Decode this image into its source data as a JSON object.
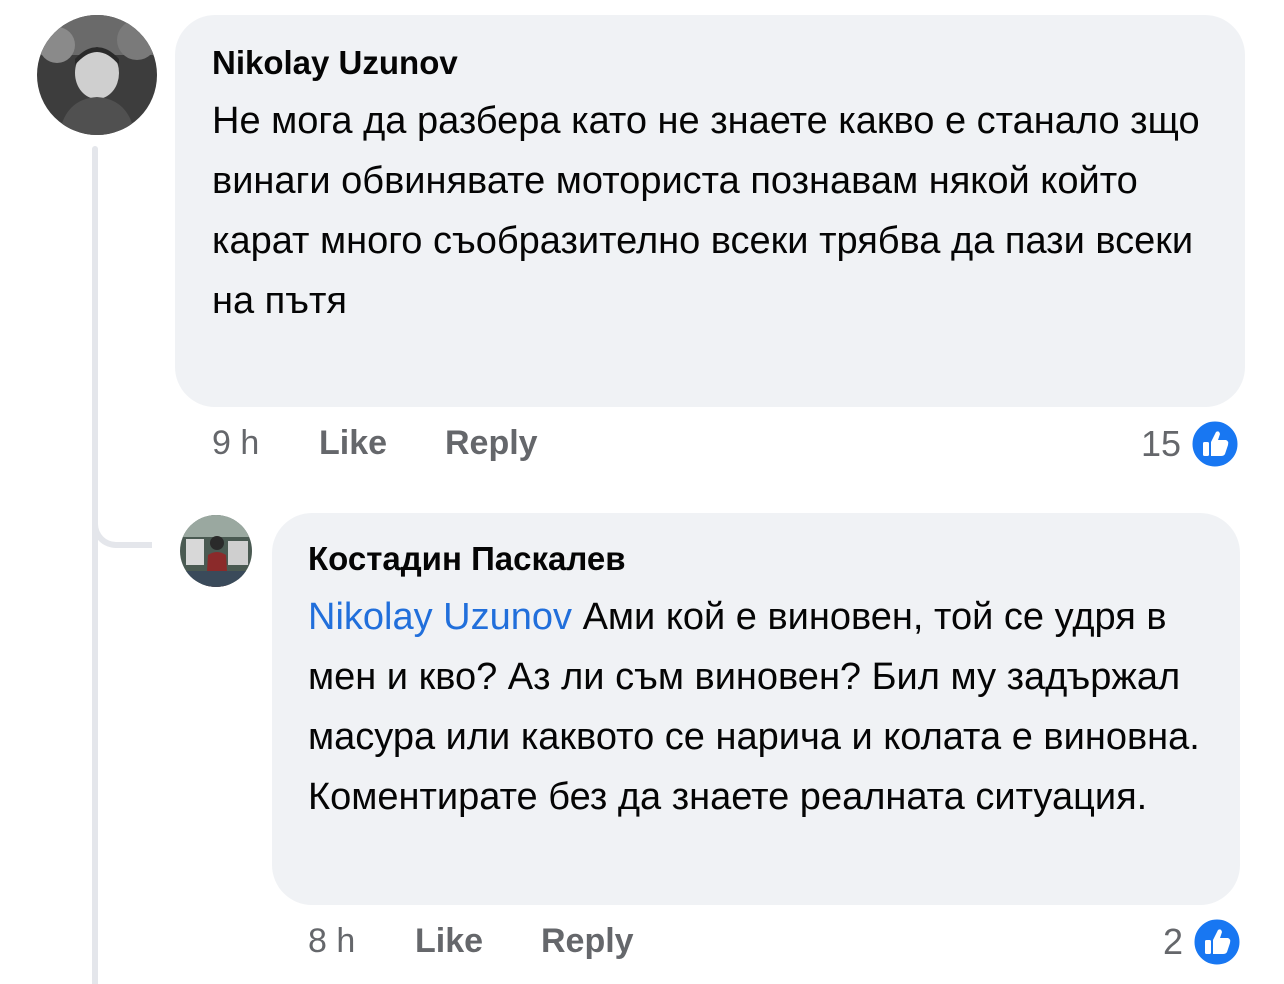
{
  "comments": [
    {
      "author": "Nikolay Uzunov",
      "text": "Не мога да разбера като не знаете какво е станало зщо винаги обвинявате моториста познавам някой който карат много съобразително всеки трябва да пази всеки на пътя",
      "time": "9 h",
      "like_label": "Like",
      "reply_label": "Reply",
      "reaction_count": "15",
      "reaction_icon": "like-icon"
    },
    {
      "author": "Костадин Паскалев",
      "mention": "Nikolay Uzunov",
      "text": "Ами кой е виновен, той се удря в мен и кво? Аз ли съм  виновен? Бил му задържал масура или каквото се нарича и колата е виновна. Коментирате без да знаете реалната ситуация.",
      "time": "8 h",
      "like_label": "Like",
      "reply_label": "Reply",
      "reaction_count": "2",
      "reaction_icon": "like-icon"
    }
  ],
  "colors": {
    "bubble": "#f0f2f5",
    "mention": "#216fdb",
    "meta": "#65676b",
    "like_badge": "#1877f2"
  }
}
